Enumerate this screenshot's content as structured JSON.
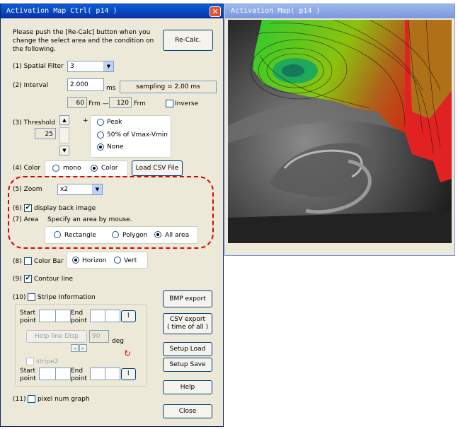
{
  "ctrl": {
    "title": "Activation Map Ctrl( p14 )",
    "instructions": "Please push the [Re-Calc] button when you change the select area and the condition on the following.",
    "recalc_label": "Re-Calc.",
    "spatial_filter": {
      "label": "(1) Spatial Filter",
      "value": "3"
    },
    "interval": {
      "label": "(2) Interval",
      "value": "2.000",
      "unit": "ms",
      "sampling": "sampling = 2.00 ms",
      "from_frame": "60",
      "to_frame": "120",
      "frm_label": "Frm",
      "frm_dash": "Frm —",
      "inverse_label": "Inverse"
    },
    "threshold": {
      "label": "(3) Threshold",
      "value": "25",
      "plus": "+",
      "options": [
        "Peak",
        "50% of Vmax-Vmin",
        "None"
      ]
    },
    "color": {
      "label": "(4) Color",
      "options": [
        "mono",
        "Color"
      ],
      "load_csv_label": "Load CSV File"
    },
    "zoom": {
      "label": "(5) Zoom",
      "value": "x2"
    },
    "back_image": {
      "label": "(6)",
      "checkbox_label": "display back image"
    },
    "area": {
      "label": "(7) Area",
      "hint": "Specify an area by mouse.",
      "options": [
        "Rectangle",
        "Polygon",
        "All area"
      ]
    },
    "color_bar": {
      "label": "(8)",
      "checkbox_label": "Color Bar",
      "options": [
        "Horizon",
        "Vert"
      ]
    },
    "contour": {
      "label": "(9)",
      "checkbox_label": "Contour line"
    },
    "stripe": {
      "label": "(10)",
      "checkbox_label": "Stripe Information",
      "start_point": "Start point",
      "end_point": "End point",
      "help_line_label": "Help line Disp",
      "angle_value": "90",
      "deg_label": "deg",
      "stripe2_label": "stripe2"
    },
    "pixel_graph": {
      "label": "(11)",
      "checkbox_label": "pixel num graph"
    },
    "buttons": {
      "bmp_export": "BMP export",
      "csv_export_line1": "CSV export",
      "csv_export_line2": "( time of all )",
      "setup_load": "Setup Load",
      "setup_save": "Setup Save",
      "help": "Help",
      "close": "Close"
    }
  },
  "map": {
    "title": "Activation Map( p14 )"
  },
  "colors": {
    "titlebar": "#0a246a",
    "titlebar_inactive": "#7a96df",
    "window_bg": "#ece9d8",
    "highlight": "#dd0000"
  }
}
